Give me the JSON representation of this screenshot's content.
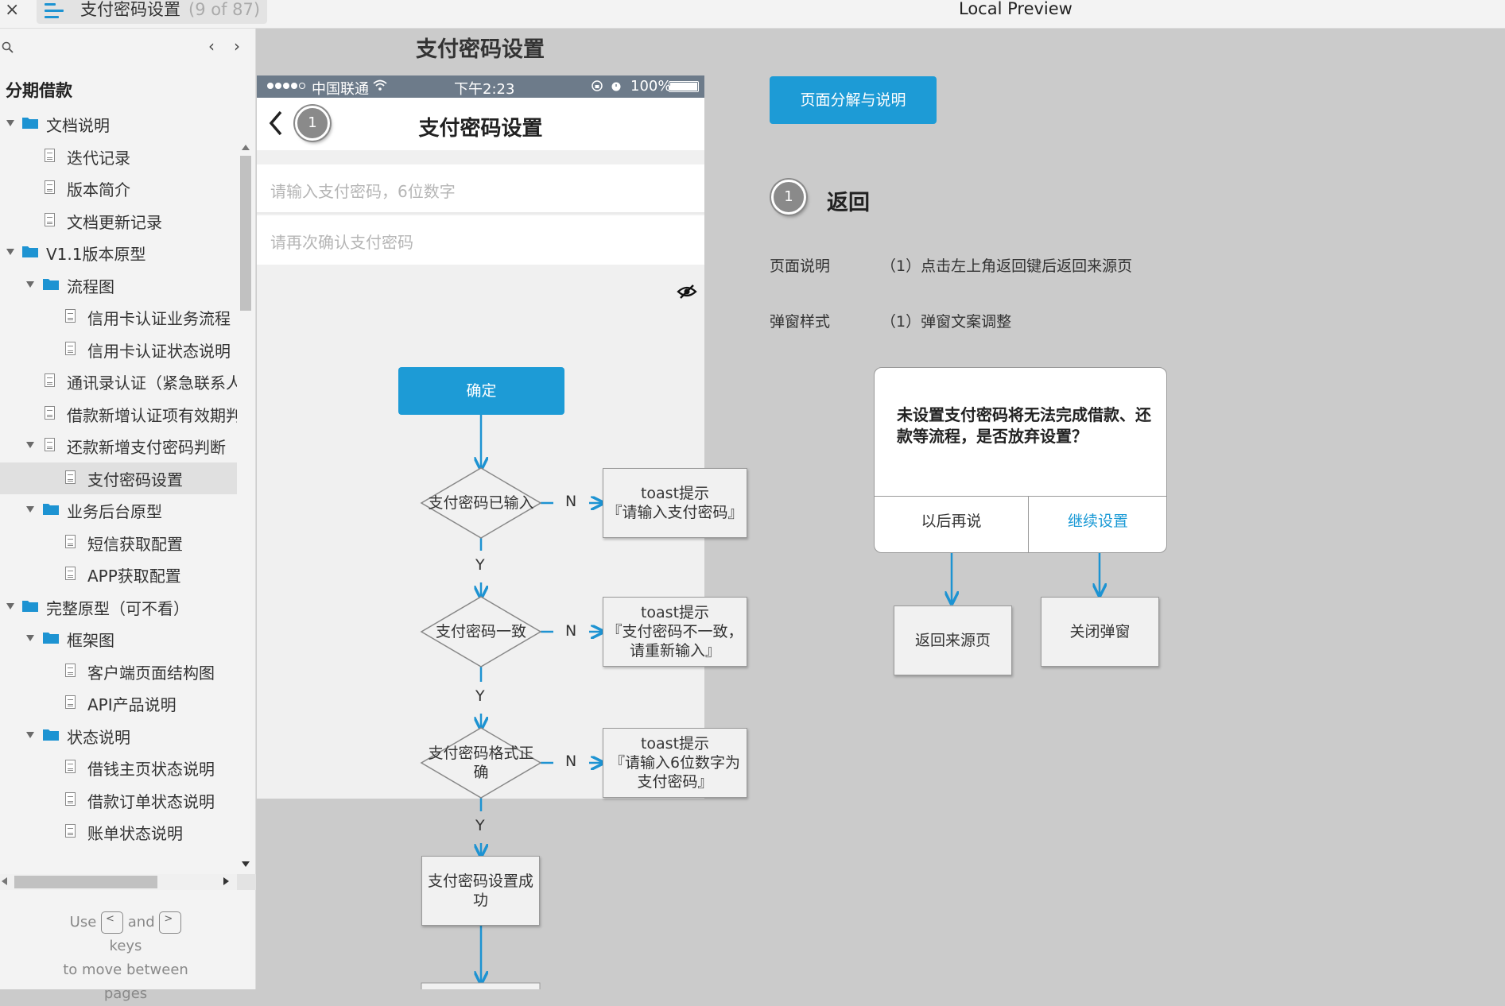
{
  "window": {
    "close_label": "×",
    "doc_title": "支付密码设置",
    "doc_count": "(9 of 87)",
    "preview_title": "Local Preview"
  },
  "sidebar": {
    "prev_label": "‹",
    "next_label": "›",
    "heading": "分期借款",
    "items": [
      {
        "label": "文档说明",
        "kind": "folder",
        "level": 0,
        "expanded": true
      },
      {
        "label": "迭代记录",
        "kind": "page",
        "level": 1
      },
      {
        "label": "版本简介",
        "kind": "page",
        "level": 1
      },
      {
        "label": "文档更新记录",
        "kind": "page",
        "level": 1
      },
      {
        "label": "V1.1版本原型",
        "kind": "folder",
        "level": 0,
        "expanded": true
      },
      {
        "label": "流程图",
        "kind": "folder",
        "level": 1,
        "expanded": true
      },
      {
        "label": "信用卡认证业务流程",
        "kind": "page",
        "level": 2
      },
      {
        "label": "信用卡认证状态说明",
        "kind": "page",
        "level": 2
      },
      {
        "label": "通讯录认证（紧急联系人",
        "kind": "page",
        "level": 1
      },
      {
        "label": "借款新增认证项有效期判断",
        "kind": "page",
        "level": 1
      },
      {
        "label": "还款新增支付密码判断",
        "kind": "page",
        "level": 1,
        "expanded": true
      },
      {
        "label": "支付密码设置",
        "kind": "page",
        "level": 2,
        "selected": true
      },
      {
        "label": "业务后台原型",
        "kind": "folder",
        "level": 1,
        "expanded": true
      },
      {
        "label": "短信获取配置",
        "kind": "page",
        "level": 2
      },
      {
        "label": "APP获取配置",
        "kind": "page",
        "level": 2
      },
      {
        "label": "完整原型（可不看）",
        "kind": "folder",
        "level": 0,
        "expanded": true
      },
      {
        "label": "框架图",
        "kind": "folder",
        "level": 1,
        "expanded": true
      },
      {
        "label": "客户端页面结构图",
        "kind": "page",
        "level": 2
      },
      {
        "label": "API产品说明",
        "kind": "page",
        "level": 2
      },
      {
        "label": "状态说明",
        "kind": "folder",
        "level": 1,
        "expanded": true
      },
      {
        "label": "借钱主页状态说明",
        "kind": "page",
        "level": 2
      },
      {
        "label": "借款订单状态说明",
        "kind": "page",
        "level": 2
      },
      {
        "label": "账单状态说明",
        "kind": "page",
        "level": 2
      }
    ],
    "help": {
      "use": "Use",
      "key_prev": "<",
      "and": "and",
      "key_next": ">",
      "keys": "keys",
      "move": "to move between",
      "pages": "pages"
    }
  },
  "page": {
    "heading": "支付密码设置",
    "phone": {
      "carrier": "中国联通",
      "time": "下午2:23",
      "battery_pct": "100%",
      "nav_title": "支付密码设置",
      "marker": "1",
      "pw_placeholder": "请输入支付密码，6位数字",
      "pw_confirm_placeholder": "请再次确认支付密码",
      "confirm_label": "确定"
    },
    "flow": {
      "d1": "支付密码已输入",
      "d2": "支付密码一致",
      "d3_line1": "支付密码格式正",
      "d3_line2": "确",
      "t1_line1": "toast提示",
      "t1_line2": "『请输入支付密码』",
      "t2_line1": "toast提示",
      "t2_line2": "『支付密码不一致，",
      "t2_line3": "请重新输入』",
      "t3_line1": "toast提示",
      "t3_line2": "『请输入6位数字为",
      "t3_line3": "支付密码』",
      "success_line1": "支付密码设置成",
      "success_line2": "功",
      "yes": "Y",
      "no": "N"
    },
    "explain": {
      "button_label": "页面分解与说明",
      "marker": "1",
      "section_title": "返回",
      "desc1_label": "页面说明",
      "desc1_text": "（1）点击左上角返回键后返回来源页",
      "desc2_label": "弹窗样式",
      "desc2_text": "（1）弹窗文案调整"
    },
    "dialog": {
      "message": "未设置支付密码将无法完成借款、还款等流程，是否放弃设置？",
      "later": "以后再说",
      "continue": "继续设置",
      "result_back": "返回来源页",
      "result_close": "关闭弹窗"
    }
  },
  "colors": {
    "accent": "#1d9bd6",
    "statusbar": "#6d7b8a",
    "marker": "#8a8a8a"
  }
}
